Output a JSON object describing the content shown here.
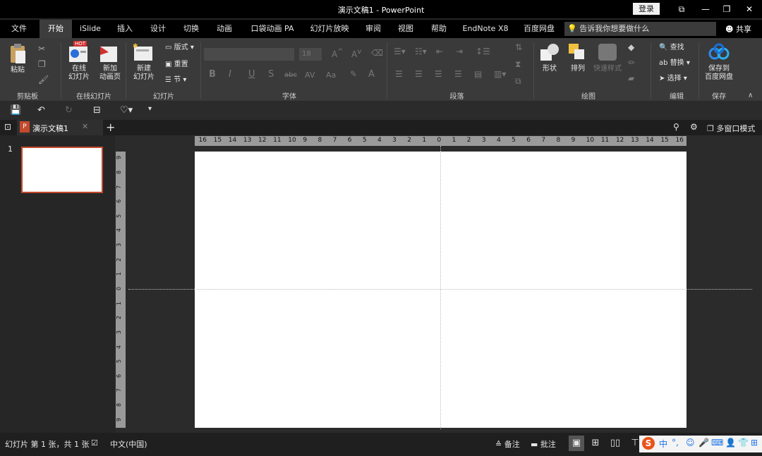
{
  "window": {
    "title": "演示文稿1  -  PowerPoint",
    "login_label": "登录",
    "minimize": "—",
    "restore": "❐",
    "close": "✕",
    "ribbon_display": "⧉"
  },
  "tabs": [
    {
      "label": "文件"
    },
    {
      "label": "开始"
    },
    {
      "label": "iSlide"
    },
    {
      "label": "插入"
    },
    {
      "label": "设计"
    },
    {
      "label": "切换"
    },
    {
      "label": "动画"
    },
    {
      "label": "口袋动画 PA"
    },
    {
      "label": "幻灯片放映"
    },
    {
      "label": "审阅"
    },
    {
      "label": "视图"
    },
    {
      "label": "帮助"
    },
    {
      "label": "EndNote X8"
    },
    {
      "label": "百度网盘"
    }
  ],
  "tellme_placeholder": "告诉我你想要做什么",
  "share_label": "共享",
  "ribbon": {
    "clipboard": {
      "paste": "粘贴",
      "group": "剪贴板"
    },
    "online": {
      "hot": "HOT",
      "online_slides": "在线\n幻灯片",
      "new_anim": "新加\n动画页",
      "group": "在线幻灯片"
    },
    "slides": {
      "new_slide": "新建\n幻灯片",
      "layout": "版式",
      "reset": "重置",
      "section": "节",
      "group": "幻灯片"
    },
    "font": {
      "size": "18",
      "bold": "B",
      "italic": "I",
      "underline": "U",
      "strike": "S",
      "abc": "abc",
      "av": "AV",
      "aa": "Aa",
      "a": "A",
      "group": "字体"
    },
    "paragraph": {
      "group": "段落"
    },
    "drawing": {
      "shape": "形状",
      "arrange": "排列",
      "quick_style": "快速样式",
      "group": "绘图"
    },
    "editing": {
      "find": "查找",
      "replace": "替换",
      "select": "选择",
      "group": "编辑"
    },
    "save": {
      "save_to": "保存到\n百度网盘",
      "group": "保存"
    }
  },
  "doc": {
    "name": "演示文稿1",
    "multiwin": "多窗口模式"
  },
  "slides": [
    {
      "number": "1"
    }
  ],
  "ruler": {
    "h": [
      "16",
      "15",
      "14",
      "13",
      "12",
      "11",
      "10",
      "9",
      "8",
      "7",
      "6",
      "5",
      "4",
      "3",
      "2",
      "1",
      "0",
      "1",
      "2",
      "3",
      "4",
      "5",
      "6",
      "7",
      "8",
      "9",
      "10",
      "11",
      "12",
      "13",
      "14",
      "15",
      "16"
    ],
    "v": [
      "9",
      "8",
      "7",
      "6",
      "5",
      "4",
      "3",
      "2",
      "1",
      "0",
      "1",
      "2",
      "3",
      "4",
      "5",
      "6",
      "7",
      "8",
      "9"
    ]
  },
  "status": {
    "slide_info": "幻灯片 第 1 张，共 1 张",
    "language": "中文(中国)",
    "notes": "备注",
    "comments": "批注"
  },
  "ime": {
    "logo": "S",
    "mode": "中",
    "punct": "°,"
  },
  "colors": {
    "accent": "#c44a2e",
    "titlebar": "#000000",
    "ribbon": "#3a3a3a"
  }
}
